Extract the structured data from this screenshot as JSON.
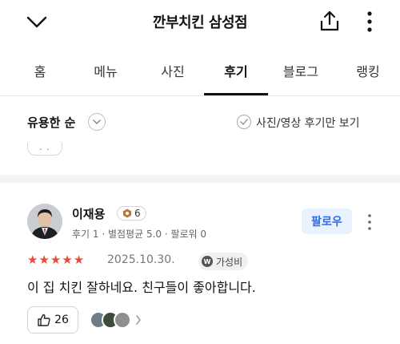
{
  "header": {
    "title": "깐부치킨 삼성점"
  },
  "tabs": [
    {
      "label": "홈",
      "active": false
    },
    {
      "label": "메뉴",
      "active": false
    },
    {
      "label": "사진",
      "active": false
    },
    {
      "label": "후기",
      "active": true
    },
    {
      "label": "블로그",
      "active": false
    },
    {
      "label": "랭킹",
      "active": false
    }
  ],
  "sort": {
    "label": "유용한 순",
    "filter_label": "사진/영상 후기만 보기"
  },
  "review": {
    "author": "이재용",
    "badge_count": "6",
    "stats": "후기 1 · 별점평균 5.0 · 팔로워 0",
    "follow_label": "팔로우",
    "rating": 5,
    "date": "2025.10.30.",
    "receipt_label": "가성비",
    "receipt_icon_letter": "W",
    "text": "이 집 치킨 잘하네요. 친구들이 좋아합니다.",
    "like_count": "26"
  },
  "colors": {
    "accent_blue": "#2f6de0",
    "follow_bg": "#eaf1ff",
    "star_red": "#e8493a",
    "badge_brown": "#b5793f"
  }
}
